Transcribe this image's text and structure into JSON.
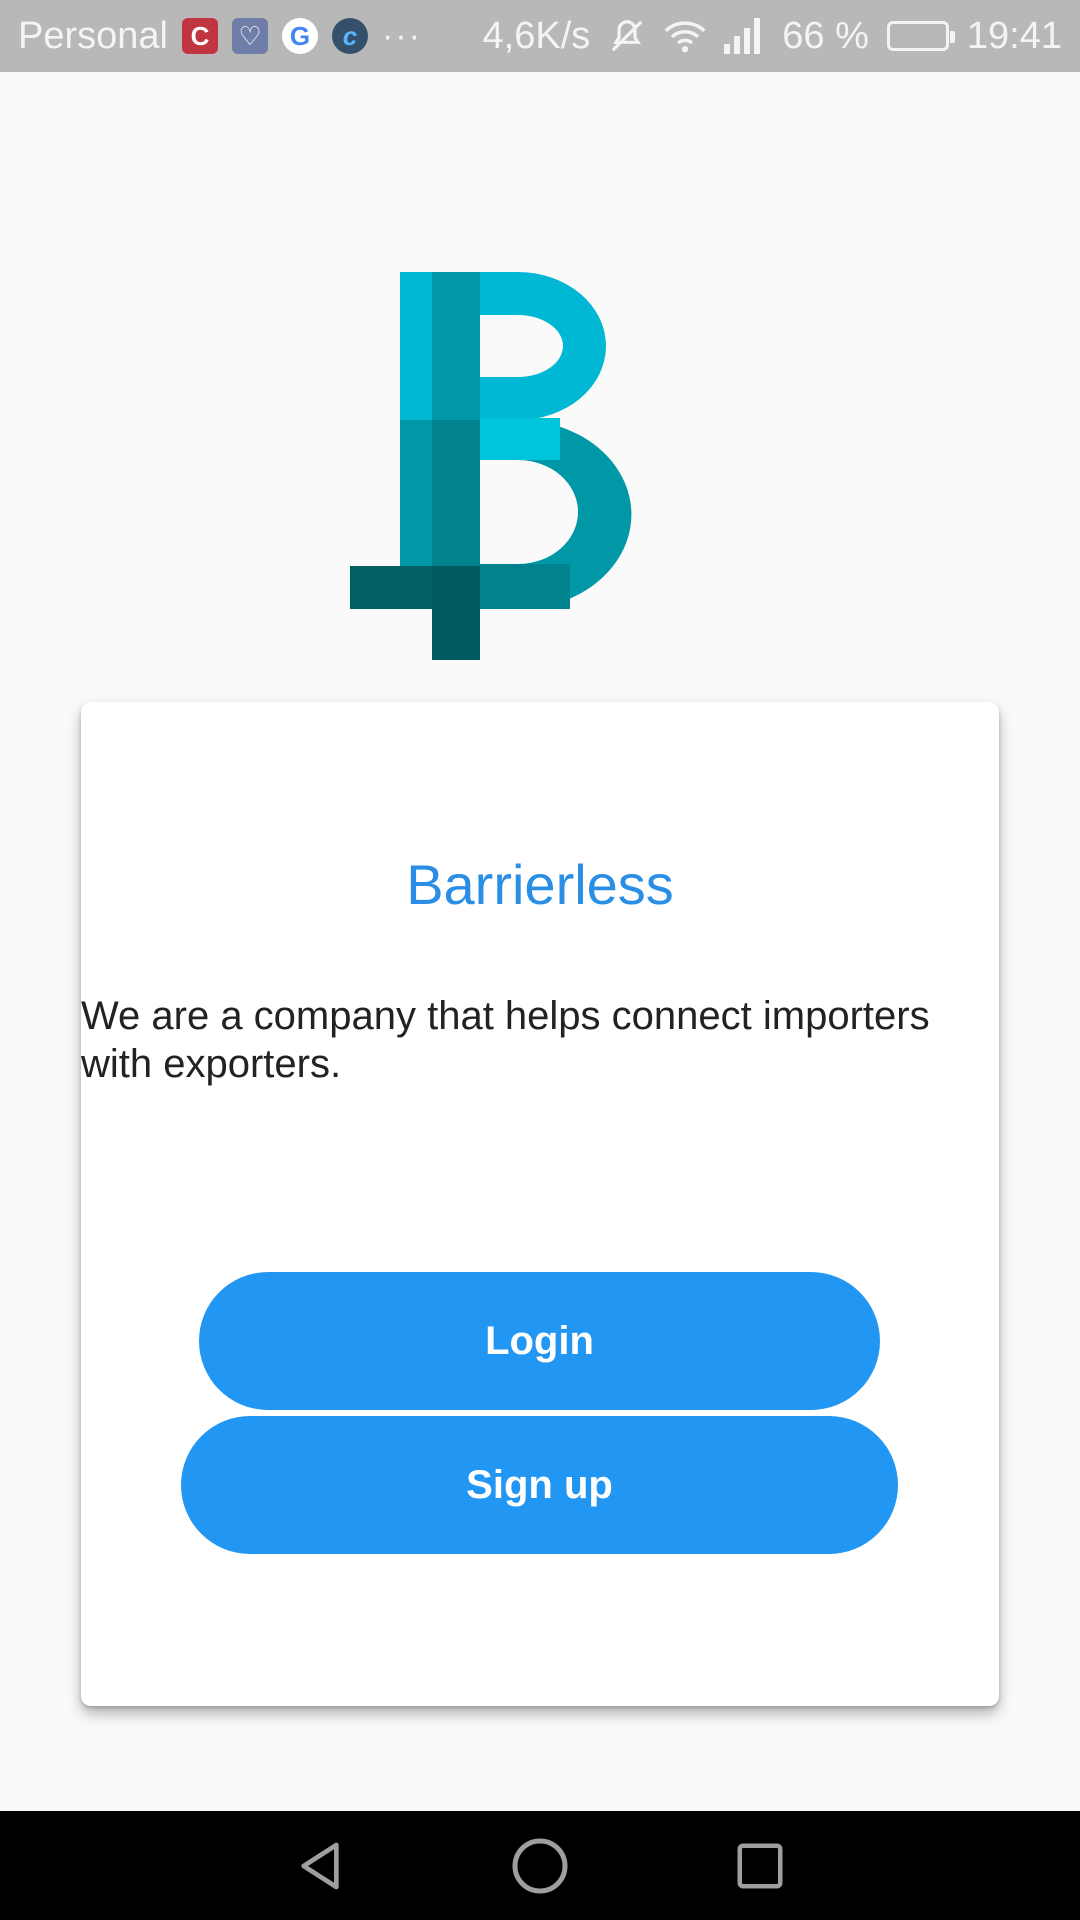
{
  "status_bar": {
    "profile": "Personal",
    "network_speed": "4,6K/s",
    "battery_percent": "66 %",
    "time": "19:41",
    "notification_icons": [
      "c-app-icon",
      "health-icon",
      "google-icon",
      "c-circle-icon"
    ],
    "status_icons": [
      "mute-icon",
      "wifi-icon",
      "signal-icon",
      "battery-icon"
    ]
  },
  "logo": {
    "name": "barrierless-logo",
    "colors": [
      "#00b8d4",
      "#0097a7",
      "#00838f",
      "#006064",
      "#00c4dc"
    ]
  },
  "card": {
    "title": "Barrierless",
    "description": "We are a company that helps connect importers with exporters.",
    "login_label": "Login",
    "signup_label": "Sign up"
  },
  "nav": {
    "icons": [
      "back-icon",
      "home-icon",
      "recents-icon"
    ]
  },
  "colors": {
    "accent": "#2196f3",
    "title": "#2a8fe4",
    "background": "#fafafa"
  }
}
